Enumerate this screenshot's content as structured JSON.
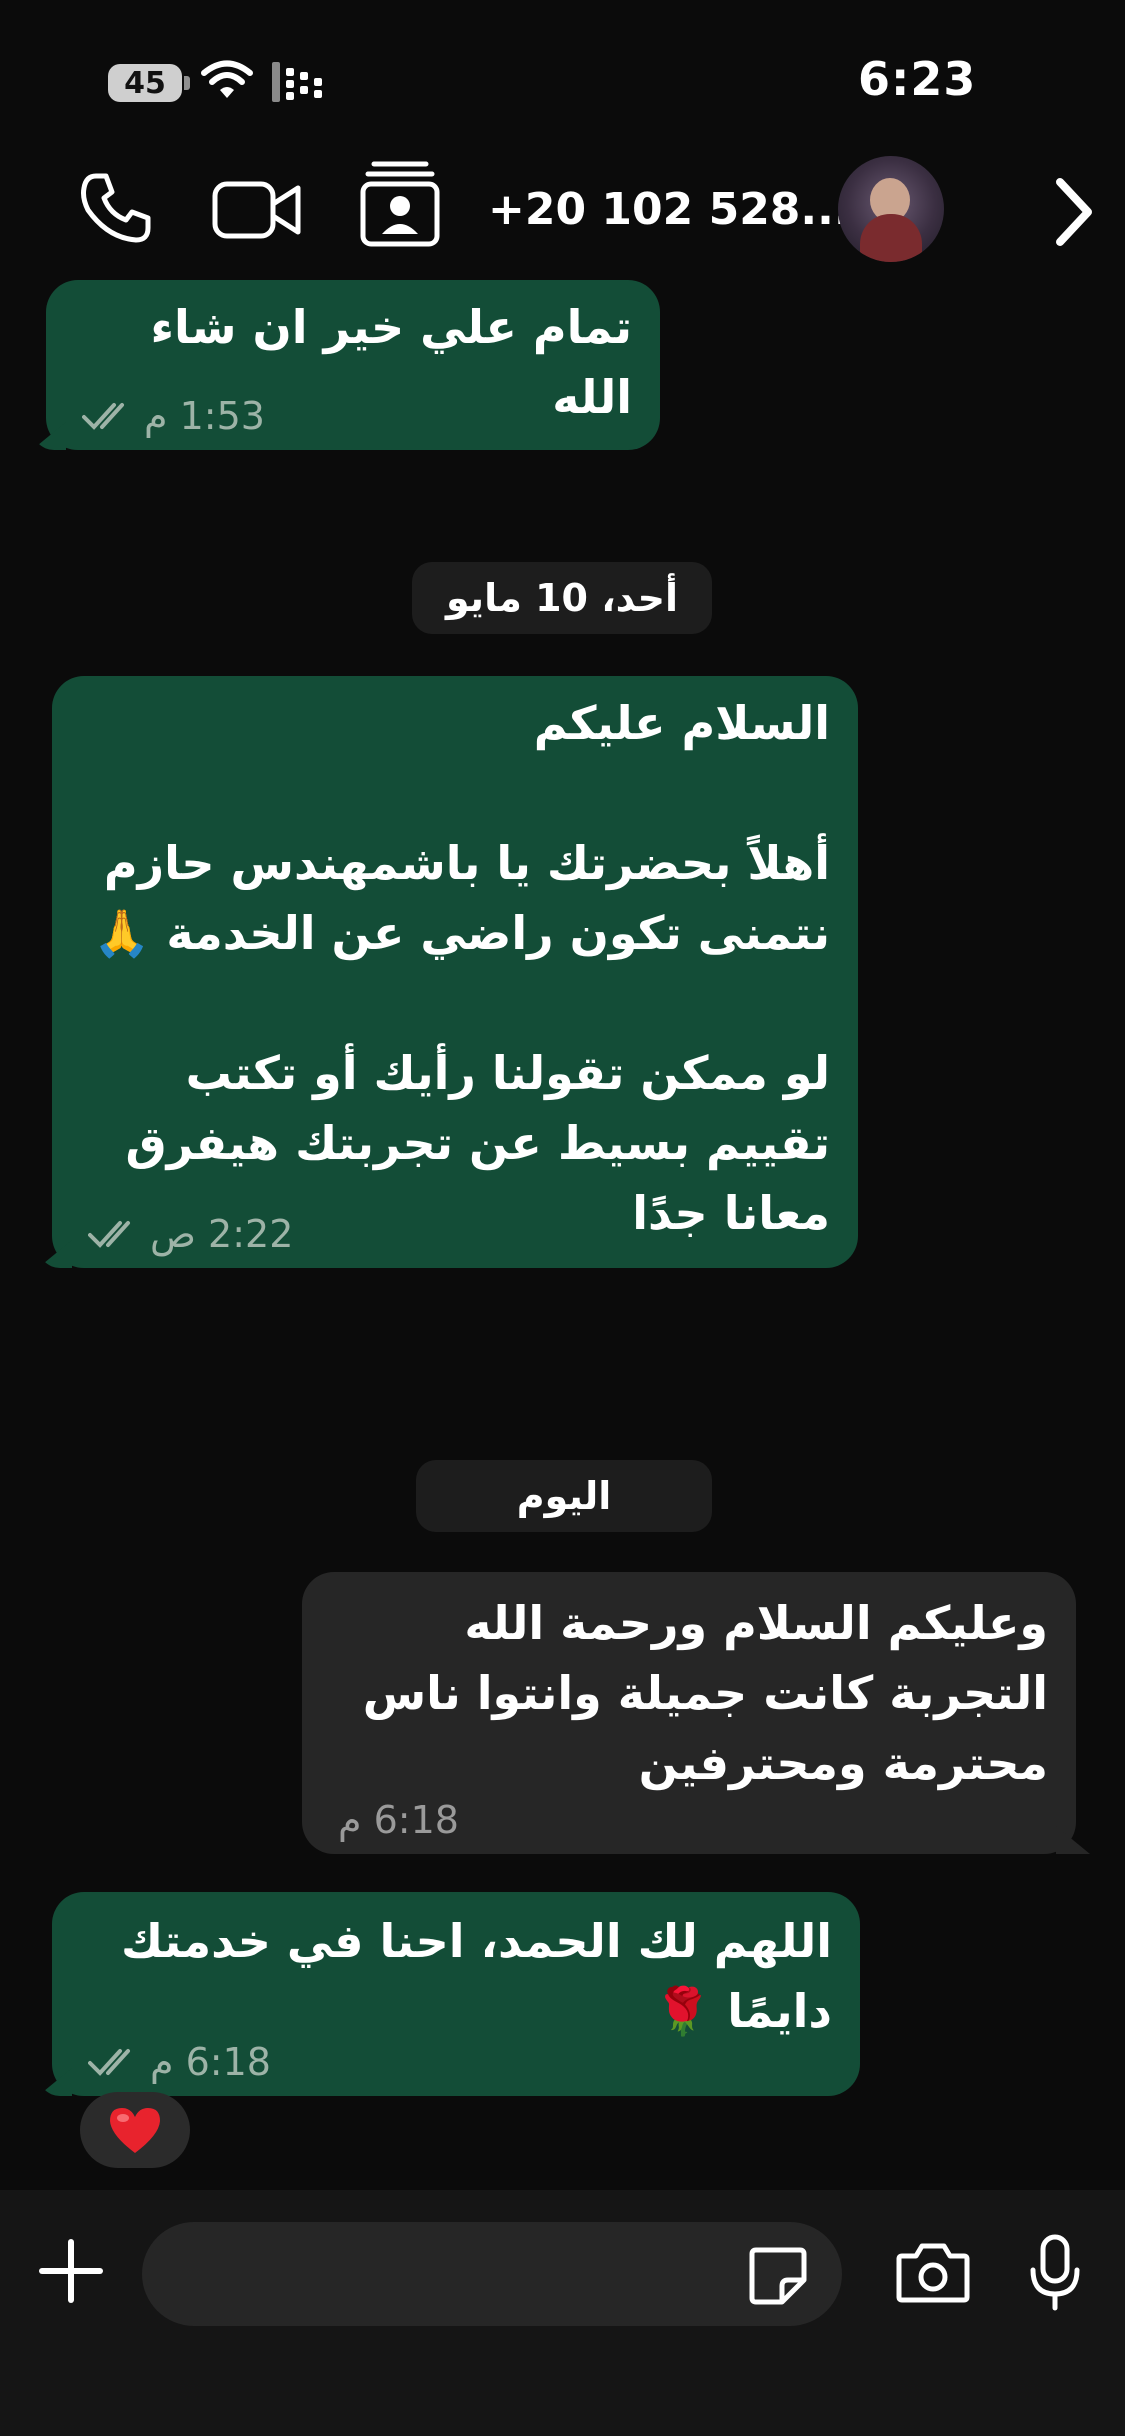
{
  "status_bar": {
    "battery_level": "45",
    "time": "6:23"
  },
  "header": {
    "contact_name": "+20 102 528...",
    "icons": [
      "phone-icon",
      "video-camera-icon",
      "contact-card-icon",
      "chevron-right-icon"
    ]
  },
  "messages": [
    {
      "direction": "incoming",
      "text": "تمام علي خير ان شاء الله",
      "time": "1:53 م",
      "status": "read"
    },
    {
      "type": "date",
      "label": "أحد، 10 مايو"
    },
    {
      "direction": "incoming",
      "text": "السلام عليكم\n\nأهلاً بحضرتك يا باشمهندس حازم\nنتمنى تكون راضي عن الخدمة 🙏\n\nلو ممكن تقولنا رأيك أو تكتب\nتقييم بسيط عن تجربتك هيفرق\nمعانا جدًا",
      "time": "2:22 ص",
      "status": "read"
    },
    {
      "type": "date",
      "label": "اليوم"
    },
    {
      "direction": "outgoing",
      "text": "وعليكم السلام ورحمة الله\nالتجربة كانت جميلة وانتوا ناس\nمحترمة ومحترفين",
      "time": "6:18 م"
    },
    {
      "direction": "incoming",
      "text": "اللهم لك الحمد، احنا في خدمتك\nدايمًا 🌹",
      "time": "6:18 م",
      "status": "read",
      "reaction": "❤️"
    }
  ],
  "input": {
    "placeholder": "",
    "value": ""
  },
  "colors": {
    "background": "#0b0b0b",
    "incoming_bubble": "#134d37",
    "outgoing_bubble": "#262626",
    "date_chip": "#1d1d1d",
    "input_bar": "#151515"
  }
}
